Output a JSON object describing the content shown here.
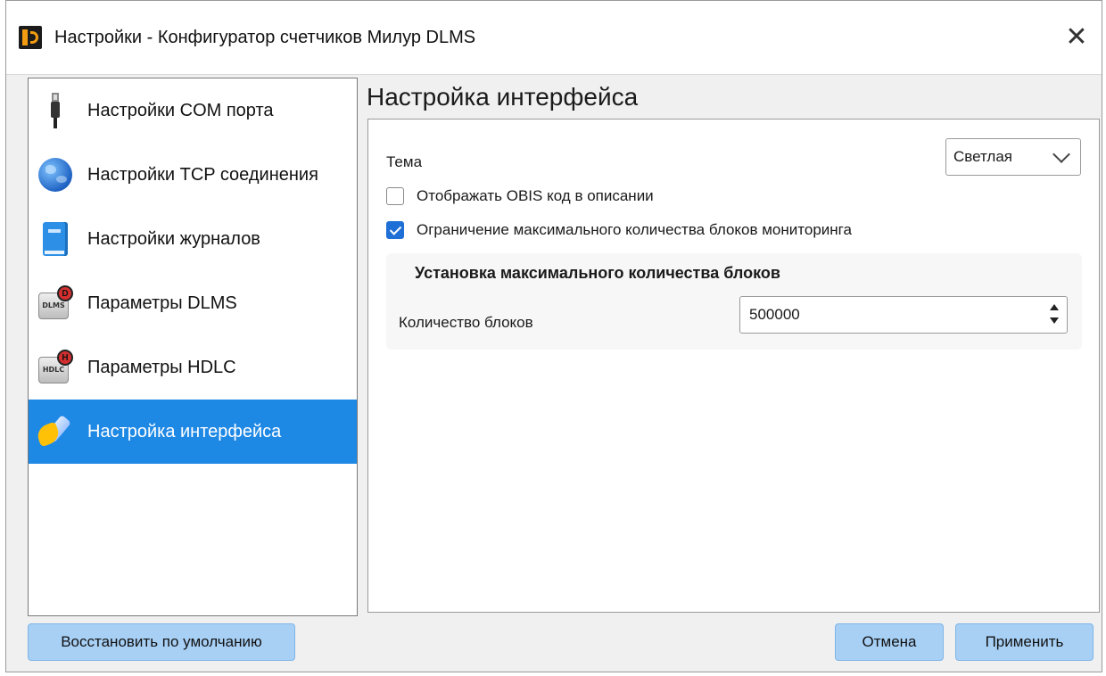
{
  "window": {
    "title": "Настройки - Конфигуратор счетчиков Милур DLMS",
    "close_glyph": "✕"
  },
  "sidebar": {
    "items": [
      {
        "label": "Настройки COM порта",
        "icon": "usb-plug-icon",
        "selected": false
      },
      {
        "label": "Настройки TCP соединения",
        "icon": "globe-icon",
        "selected": false
      },
      {
        "label": "Настройки журналов",
        "icon": "book-icon",
        "selected": false
      },
      {
        "label": "Параметры DLMS",
        "icon": "dlms-chip-icon",
        "icon_text": "DLMS",
        "badge": "D",
        "selected": false
      },
      {
        "label": "Параметры HDLC",
        "icon": "hdlc-chip-icon",
        "icon_text": "HDLC",
        "badge": "H",
        "selected": false
      },
      {
        "label": "Настройка интерфейса",
        "icon": "paint-brush-icon",
        "selected": true
      }
    ]
  },
  "content": {
    "title": "Настройка интерфейса",
    "theme": {
      "label": "Тема",
      "value": "Светлая"
    },
    "options": [
      {
        "label": "Отображать OBIS  код в описании",
        "checked": false
      },
      {
        "label": "Ограничение максимального количества блоков мониторинга",
        "checked": true
      }
    ],
    "group": {
      "title": "Установка максимального количества блоков",
      "count_label": "Количество блоков",
      "count_value": "500000"
    }
  },
  "buttons": {
    "restore": "Восстановить по умолчанию",
    "cancel": "Отмена",
    "apply": "Применить"
  },
  "colors": {
    "selection": "#1e88e5",
    "button": "#a8d0f5",
    "checkbox": "#1e6fd6"
  }
}
